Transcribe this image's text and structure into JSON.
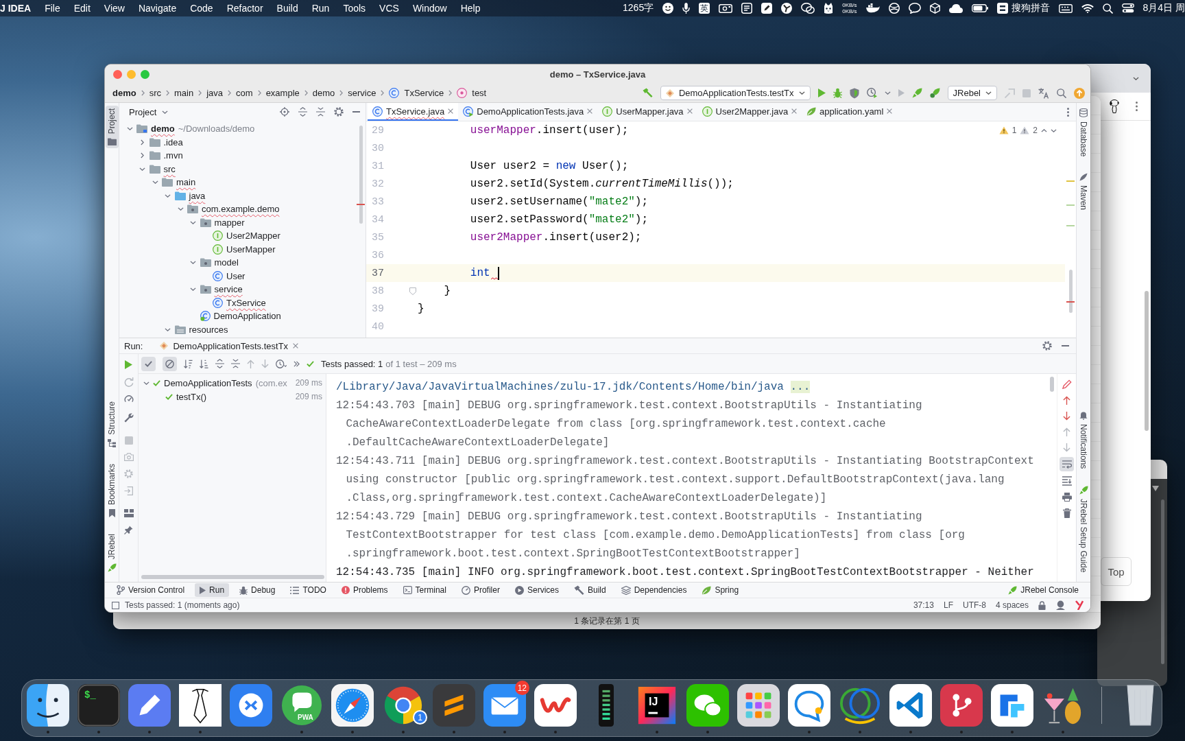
{
  "menu_bar": {
    "app_name": "J IDEA",
    "menus": [
      "File",
      "Edit",
      "View",
      "Navigate",
      "Code",
      "Refactor",
      "Build",
      "Run",
      "Tools",
      "VCS",
      "Window",
      "Help"
    ],
    "word_count": "1265字",
    "input_source": "英",
    "upload_speed": "0KB/s",
    "download_speed": "0KB/s",
    "input_method": "搜狗拼音",
    "clock": "8月4日 周"
  },
  "table_window": {
    "footer": "1 条记录在第 1 页"
  },
  "browser_window": {
    "top_button": "Top"
  },
  "ide_window": {
    "title": "demo – TxService.java",
    "breadcrumbs": [
      {
        "text": "demo",
        "kind": "project"
      },
      {
        "text": "src",
        "kind": "folder"
      },
      {
        "text": "main",
        "kind": "folder"
      },
      {
        "text": "java",
        "kind": "folder"
      },
      {
        "text": "com",
        "kind": "folder"
      },
      {
        "text": "example",
        "kind": "folder"
      },
      {
        "text": "demo",
        "kind": "folder"
      },
      {
        "text": "service",
        "kind": "folder"
      },
      {
        "text": "TxService",
        "kind": "class"
      },
      {
        "text": "test",
        "kind": "method"
      }
    ],
    "run_configuration": "DemoApplicationTests.testTx",
    "jrebel_button": "JRebel",
    "left_tool_strip": {
      "top": [
        {
          "label": "Project",
          "kind": "project",
          "selected": true
        }
      ],
      "bottom": [
        {
          "label": "Structure",
          "kind": "structure",
          "selected": false
        },
        {
          "label": "Bookmarks",
          "kind": "bookmarks",
          "selected": false
        },
        {
          "label": "JRebel",
          "kind": "jrebel",
          "selected": false
        }
      ]
    },
    "project_panel": {
      "title": "Project",
      "tree": [
        {
          "name": "demo",
          "path": "~/Downloads/demo",
          "kind": "module",
          "expanded": true,
          "error": true,
          "children": [
            {
              "name": ".idea",
              "kind": "folder",
              "expanded": false,
              "error": false
            },
            {
              "name": ".mvn",
              "kind": "folder",
              "expanded": false,
              "error": false
            },
            {
              "name": "src",
              "kind": "folder",
              "expanded": true,
              "error": true,
              "children": [
                {
                  "name": "main",
                  "kind": "folder",
                  "expanded": true,
                  "error": true,
                  "children": [
                    {
                      "name": "java",
                      "kind": "source",
                      "expanded": true,
                      "error": true,
                      "children": [
                        {
                          "name": "com.example.demo",
                          "kind": "package",
                          "expanded": true,
                          "error": true,
                          "children": [
                            {
                              "name": "mapper",
                              "kind": "package",
                              "expanded": true,
                              "error": false,
                              "children": [
                                {
                                  "name": "User2Mapper",
                                  "kind": "interface",
                                  "error": false
                                },
                                {
                                  "name": "UserMapper",
                                  "kind": "interface",
                                  "error": false
                                }
                              ]
                            },
                            {
                              "name": "model",
                              "kind": "package",
                              "expanded": true,
                              "error": false,
                              "children": [
                                {
                                  "name": "User",
                                  "kind": "class",
                                  "error": false
                                }
                              ]
                            },
                            {
                              "name": "service",
                              "kind": "package",
                              "expanded": true,
                              "error": true,
                              "children": [
                                {
                                  "name": "TxService",
                                  "kind": "class",
                                  "error": true
                                }
                              ]
                            },
                            {
                              "name": "DemoApplication",
                              "kind": "spring",
                              "error": false
                            }
                          ]
                        }
                      ]
                    },
                    {
                      "name": "resources",
                      "kind": "resources",
                      "expanded": true,
                      "error": false
                    }
                  ]
                }
              ]
            }
          ]
        }
      ]
    },
    "editor_tabs": [
      {
        "label": "TxService.java",
        "kind": "class",
        "selected": true,
        "error": true
      },
      {
        "label": "DemoApplicationTests.java",
        "kind": "test",
        "selected": false,
        "error": false
      },
      {
        "label": "UserMapper.java",
        "kind": "interface",
        "selected": false,
        "error": false
      },
      {
        "label": "User2Mapper.java",
        "kind": "interface",
        "selected": false,
        "error": false
      },
      {
        "label": "application.yaml",
        "kind": "yaml",
        "selected": false,
        "error": false
      }
    ],
    "inspections": {
      "warnings": "1",
      "weak_warnings": "2"
    },
    "code_lines": [
      {
        "number": "29",
        "current": false,
        "error": false,
        "fold": false,
        "tokens": [
          {
            "text": "        userMapper",
            "kind": "field"
          },
          {
            "text": ".insert(user);",
            "kind": "plain"
          }
        ]
      },
      {
        "number": "30",
        "current": false,
        "error": false,
        "fold": false
      },
      {
        "number": "31",
        "current": false,
        "error": false,
        "fold": false,
        "tokens": [
          {
            "text": "        User user2 = ",
            "kind": "plain"
          },
          {
            "text": "new",
            "kind": "keyword"
          },
          {
            "text": " User();",
            "kind": "plain"
          }
        ]
      },
      {
        "number": "32",
        "current": false,
        "error": false,
        "fold": false,
        "tokens": [
          {
            "text": "        user2.setId(System.",
            "kind": "plain"
          },
          {
            "text": "currentTimeMillis",
            "kind": "static"
          },
          {
            "text": "());",
            "kind": "plain"
          }
        ]
      },
      {
        "number": "33",
        "current": false,
        "error": false,
        "fold": false,
        "tokens": [
          {
            "text": "        user2.setUsername(",
            "kind": "plain"
          },
          {
            "text": "\"mate2\"",
            "kind": "string"
          },
          {
            "text": ");",
            "kind": "plain"
          }
        ]
      },
      {
        "number": "34",
        "current": false,
        "error": false,
        "fold": false,
        "tokens": [
          {
            "text": "        user2.setPassword(",
            "kind": "plain"
          },
          {
            "text": "\"mate2\"",
            "kind": "string"
          },
          {
            "text": ");",
            "kind": "plain"
          }
        ]
      },
      {
        "number": "35",
        "current": false,
        "error": false,
        "fold": false,
        "tokens": [
          {
            "text": "        user2Mapper",
            "kind": "field"
          },
          {
            "text": ".insert(user2);",
            "kind": "plain"
          }
        ]
      },
      {
        "number": "36",
        "current": false,
        "error": false,
        "fold": false
      },
      {
        "number": "37",
        "current": true,
        "error": true,
        "fold": false,
        "tokens": [
          {
            "text": "        int",
            "kind": "keyword"
          }
        ]
      },
      {
        "number": "38",
        "current": false,
        "error": false,
        "fold": true,
        "tokens": [
          {
            "text": "    }",
            "kind": "plain"
          }
        ]
      },
      {
        "number": "39",
        "current": false,
        "error": false,
        "fold": false,
        "tokens": [
          {
            "text": "}",
            "kind": "plain"
          }
        ]
      },
      {
        "number": "40",
        "current": false,
        "error": false,
        "fold": false
      }
    ],
    "right_tool_strip": {
      "top": [
        {
          "label": "Database",
          "kind": "database",
          "selected": false
        },
        {
          "label": "Maven",
          "kind": "maven",
          "selected": false
        }
      ],
      "bottom": [
        {
          "label": "Notifications",
          "kind": "notifications",
          "selected": false
        },
        {
          "label": "JRebel Setup Guide",
          "kind": "jrebel",
          "selected": false
        }
      ]
    },
    "run_panel": {
      "label": "Run:",
      "tab": "DemoApplicationTests.testTx",
      "filters": [
        {
          "kind": "passed",
          "selected": true
        },
        {
          "kind": "ignored",
          "selected": true
        }
      ],
      "summary": "Tests passed: 1",
      "summary_detail": "of 1 test – 209 ms",
      "soft_wrap": true,
      "tests": [
        {
          "name": "DemoApplicationTests",
          "detail": "(com.ex",
          "time": "209 ms",
          "passed": true,
          "expanded": true,
          "children": [
            {
              "name": "testTx()",
              "time": "209 ms",
              "passed": true
            }
          ]
        }
      ],
      "console": [
        {
          "kind": "command",
          "lines": [
            "/Library/Java/JavaVirtualMachines/zulu-17.jdk/Contents/Home/bin/java"
          ],
          "fold": "..."
        },
        {
          "kind": "debug",
          "lines": [
            "12:54:43.703 [main] DEBUG org.springframework.test.context.BootstrapUtils - Instantiating",
            "CacheAwareContextLoaderDelegate from class [org.springframework.test.context.cache",
            ".DefaultCacheAwareContextLoaderDelegate]"
          ]
        },
        {
          "kind": "debug",
          "lines": [
            "12:54:43.711 [main] DEBUG org.springframework.test.context.BootstrapUtils - Instantiating BootstrapContext",
            "using constructor [public org.springframework.test.context.support.DefaultBootstrapContext(java.lang",
            ".Class,org.springframework.test.context.CacheAwareContextLoaderDelegate)]"
          ]
        },
        {
          "kind": "debug",
          "lines": [
            "12:54:43.729 [main] DEBUG org.springframework.test.context.BootstrapUtils - Instantiating",
            "TestContextBootstrapper for test class [com.example.demo.DemoApplicationTests] from class [org",
            ".springframework.boot.test.context.SpringBootTestContextBootstrapper]"
          ]
        },
        {
          "kind": "info",
          "lines": [
            "12:54:43.735 [main] INFO org.springframework.boot.test.context.SpringBootTestContextBootstrapper - Neither"
          ]
        }
      ]
    },
    "tool_tabs": [
      {
        "label": "Version Control",
        "kind": "vcs",
        "selected": false
      },
      {
        "label": "Run",
        "kind": "run",
        "selected": true
      },
      {
        "label": "Debug",
        "kind": "debug",
        "selected": false
      },
      {
        "label": "TODO",
        "kind": "todo",
        "selected": false
      },
      {
        "label": "Problems",
        "kind": "problems",
        "selected": false
      },
      {
        "label": "Terminal",
        "kind": "terminal",
        "selected": false
      },
      {
        "label": "Profiler",
        "kind": "profiler",
        "selected": false
      },
      {
        "label": "Services",
        "kind": "services",
        "selected": false
      },
      {
        "label": "Build",
        "kind": "build",
        "selected": false
      },
      {
        "label": "Dependencies",
        "kind": "dependencies",
        "selected": false
      },
      {
        "label": "Spring",
        "kind": "spring",
        "selected": false
      }
    ],
    "tool_tabs_right": [
      {
        "label": "JRebel Console",
        "kind": "jrebel",
        "selected": false
      }
    ],
    "status_bar": {
      "message": "Tests passed: 1 (moments ago)",
      "position": "37:13",
      "line_ending": "LF",
      "encoding": "UTF-8",
      "indent": "4 spaces"
    }
  },
  "dock": {
    "items": [
      {
        "kind": "face",
        "running": true
      },
      {
        "kind": "terminal",
        "label": "$_",
        "running": true
      },
      {
        "kind": "pencil",
        "running": true
      },
      {
        "kind": "sketch",
        "running": true
      },
      {
        "kind": "remote",
        "running": false
      },
      {
        "kind": "pwa",
        "label": "PWA",
        "running": true
      },
      {
        "kind": "compass",
        "running": true
      },
      {
        "kind": "browser",
        "badge": "1",
        "running": true
      },
      {
        "kind": "stripes",
        "running": true
      },
      {
        "kind": "mail",
        "badge": "12",
        "running": true
      },
      {
        "kind": "wave",
        "running": true
      },
      {
        "kind": "meter",
        "running": false
      },
      {
        "kind": "ide",
        "label": "IJ",
        "running": true
      },
      {
        "kind": "wechat",
        "running": true
      },
      {
        "kind": "grid",
        "running": false
      },
      {
        "kind": "chat",
        "running": true
      },
      {
        "kind": "rings",
        "running": true
      },
      {
        "kind": "code",
        "running": true
      },
      {
        "kind": "git",
        "running": true
      },
      {
        "kind": "blocks",
        "running": true
      },
      {
        "kind": "cocktail",
        "running": true
      }
    ]
  }
}
